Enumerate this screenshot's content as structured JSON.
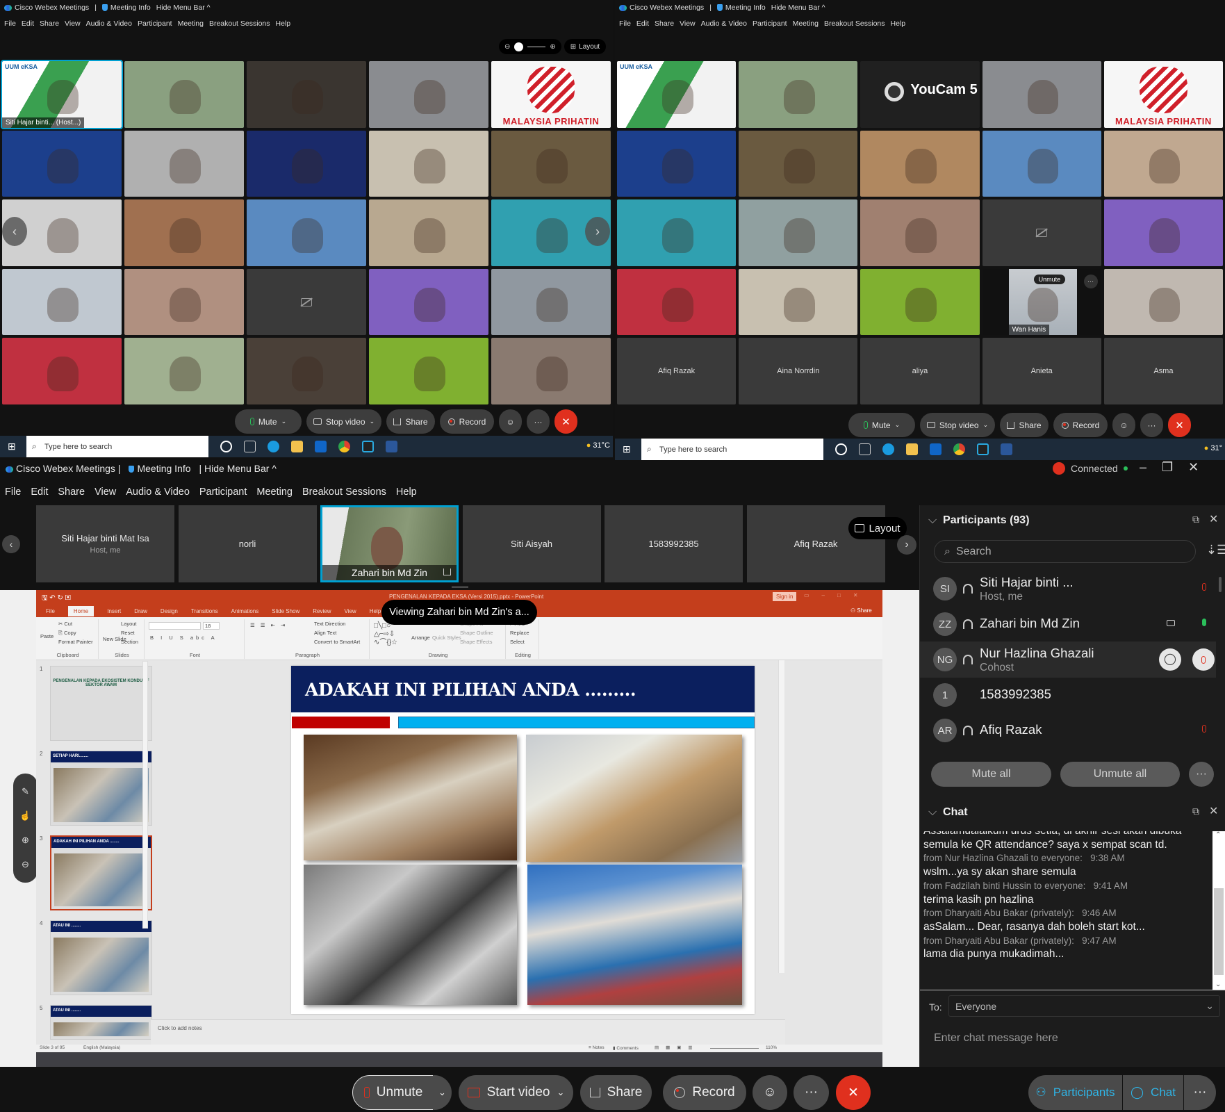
{
  "top_left": {
    "app_title": "Cisco Webex Meetings",
    "meeting_info": "Meeting Info",
    "hide_menu": "Hide Menu Bar ^",
    "menu": [
      "File",
      "Edit",
      "Share",
      "View",
      "Audio & Video",
      "Participant",
      "Meeting",
      "Breakout Sessions",
      "Help"
    ],
    "layout_label": "Layout",
    "host_tile_label": "Siti Hajar binti... (Host...)",
    "malaysia_text": "MALAYSIA PRIHATIN",
    "controls": {
      "mute": "Mute",
      "stop_video": "Stop video",
      "share": "Share",
      "record": "Record"
    },
    "taskbar": {
      "search": "Type here to search",
      "weather": "31°C"
    }
  },
  "top_right": {
    "app_title": "Cisco Webex Meetings",
    "meeting_info": "Meeting Info",
    "hide_menu": "Hide Menu Bar ^",
    "menu": [
      "File",
      "Edit",
      "Share",
      "View",
      "Audio & Video",
      "Participant",
      "Meeting",
      "Breakout Sessions",
      "Help"
    ],
    "youcam_text": "YouCam 5",
    "malaysia_text": "MALAYSIA PRIHATIN",
    "wan_hanis": "Wan Hanis",
    "unmute_popup": "Unmute",
    "name_tiles": [
      "Afiq Razak",
      "Aina Norrdin",
      "aliya",
      "Anieta",
      "Asma"
    ],
    "controls": {
      "mute": "Mute",
      "stop_video": "Stop video",
      "share": "Share",
      "record": "Record"
    },
    "taskbar": {
      "search": "Type here to search",
      "weather": "31°"
    }
  },
  "main": {
    "app_title": "Cisco Webex Meetings",
    "meeting_info": "Meeting Info",
    "hide_menu": "Hide Menu Bar ^",
    "status": "Connected",
    "menu": [
      "File",
      "Edit",
      "Share",
      "View",
      "Audio & Video",
      "Participant",
      "Meeting",
      "Breakout Sessions",
      "Help"
    ],
    "filmstrip": [
      {
        "name": "Siti Hajar binti Mat Isa",
        "sub": "Host, me"
      },
      {
        "name": "norli"
      },
      {
        "name": "Zahari bin Md Zin",
        "video": true
      },
      {
        "name": "Siti Aisyah"
      },
      {
        "name": "1583992385"
      },
      {
        "name": "Afiq Razak"
      }
    ],
    "layout_label": "Layout",
    "viewing_tooltip": "Viewing Zahari bin Md Zin's a...",
    "controls": {
      "unmute": "Unmute",
      "start_video": "Start video",
      "share": "Share",
      "record": "Record",
      "participants": "Participants",
      "chat": "Chat"
    }
  },
  "powerpoint": {
    "window_title": "PENGENALAN KEPADA EKSA (Versi 2015).pptx - PowerPoint",
    "sign_in": "Sign in",
    "share": "Share",
    "tabs": [
      "File",
      "Home",
      "Insert",
      "Draw",
      "Design",
      "Transitions",
      "Animations",
      "Slide Show",
      "Review",
      "View",
      "Help",
      "Tell me"
    ],
    "active_tab": "Home",
    "ribbon": {
      "clipboard": {
        "label": "Clipboard",
        "paste": "Paste",
        "cut": "Cut",
        "copy": "Copy",
        "format_painter": "Format Painter"
      },
      "slides": {
        "label": "Slides",
        "new_slide": "New Slide",
        "layout": "Layout",
        "reset": "Reset",
        "section": "Section"
      },
      "font": {
        "label": "Font",
        "size": "18"
      },
      "paragraph": {
        "label": "Paragraph",
        "text_direction": "Text Direction",
        "align_text": "Align Text",
        "smartart": "Convert to SmartArt"
      },
      "drawing": {
        "label": "Drawing",
        "arrange": "Arrange",
        "quick_styles": "Quick Styles",
        "shape_fill": "Shape Fill",
        "shape_outline": "Shape Outline",
        "shape_effects": "Shape Effects"
      },
      "editing": {
        "label": "Editing",
        "find": "Find",
        "replace": "Replace",
        "select": "Select"
      }
    },
    "thumbnails": [
      {
        "num": "1",
        "title": "PENGENALAN KEPADA EKOSISTEM KONDUSIF SEKTOR AWAM"
      },
      {
        "num": "2",
        "title": "SETIAP HARI........"
      },
      {
        "num": "3",
        "title": "ADAKAH INI PILIHAN ANDA ........",
        "selected": true
      },
      {
        "num": "4",
        "title": "ATAU INI ........"
      },
      {
        "num": "5",
        "title": "ATAU INI ........"
      }
    ],
    "slide_title": "ADAKAH INI PILIHAN ANDA .........",
    "notes_placeholder": "Click to add notes",
    "status": {
      "slide": "Slide 3 of 95",
      "language": "English (Malaysia)",
      "notes": "Notes",
      "comments": "Comments",
      "zoom": "110%"
    }
  },
  "participants_panel": {
    "title": "Participants (93)",
    "search_placeholder": "Search",
    "rows": [
      {
        "initials": "SI",
        "name": "Siti Hajar binti ...",
        "role": "Host, me",
        "mic": "muted"
      },
      {
        "initials": "ZZ",
        "name": "Zahari bin Md Zin",
        "mic": "active",
        "video": true,
        "sharing": true
      },
      {
        "initials": "NG",
        "name": "Nur Hazlina Ghazali",
        "role": "Cohost",
        "mic": "muted",
        "hover": true
      },
      {
        "initials": "1",
        "name": "1583992385"
      },
      {
        "initials": "AR",
        "name": "Afiq Razak",
        "mic": "muted"
      }
    ],
    "mute_all": "Mute all",
    "unmute_all": "Unmute all"
  },
  "chat_panel": {
    "title": "Chat",
    "messages": [
      {
        "text": "Assalamualaikum urus setia, di akhir sesi akan dibuka semula ke QR attendance? saya x sempat scan td."
      },
      {
        "meta": "from Nur Hazlina Ghazali to everyone:",
        "time": "9:38 AM",
        "text": "wslm...ya sy akan share semula"
      },
      {
        "meta": "from Fadzilah binti Hussin to everyone:",
        "time": "9:41 AM",
        "text": "terima kasih pn hazlina"
      },
      {
        "meta": "from Dharyaiti Abu Bakar (privately):",
        "time": "9:46 AM",
        "text": "asSalam... Dear, rasanya dah boleh start kot..."
      },
      {
        "meta": "from Dharyaiti Abu Bakar (privately):",
        "time": "9:47 AM",
        "text": "lama dia punya mukadimah..."
      }
    ],
    "to_label": "To:",
    "to_value": "Everyone",
    "input_placeholder": "Enter chat message here"
  },
  "colors": {
    "accent": "#00a0d1",
    "leave": "#e0301e",
    "muted": "#e0301e",
    "active_mic": "#2bbf5a",
    "powerpoint": "#c43e1c",
    "slide_header": "#0b1f5e"
  }
}
